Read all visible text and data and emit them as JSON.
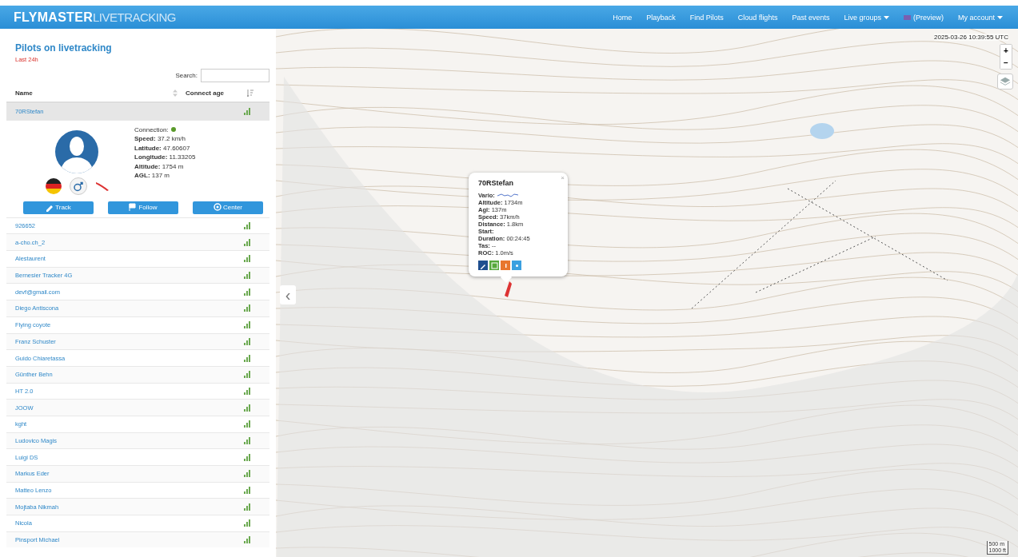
{
  "navbar": {
    "logo_bold": "FLYMASTER",
    "logo_light": "LIVETRACKING",
    "links": [
      {
        "label": "Home",
        "dropdown": false
      },
      {
        "label": "Playback",
        "dropdown": false
      },
      {
        "label": "Find Pilots",
        "dropdown": false
      },
      {
        "label": "Cloud flights",
        "dropdown": false
      },
      {
        "label": "Past events",
        "dropdown": false
      },
      {
        "label": "Live groups",
        "dropdown": true
      },
      {
        "label": "(Preview)",
        "dropdown": false,
        "flag": true
      },
      {
        "label": "My account",
        "dropdown": true
      }
    ]
  },
  "sidebar": {
    "title": "Pilots on livetracking",
    "subtitle": "Last 24h",
    "search": {
      "label": "Search:"
    },
    "columns": [
      "Name",
      "Connect age"
    ],
    "details": {
      "connection_label": "Connection:",
      "connected": true,
      "lines": [
        "**Speed:** 37.2 km/h",
        "**Latitude:** 47.60607",
        "**Longitude:** 11.33205",
        "**Altitude:** 1754 m",
        "**AGL:** 137 m"
      ],
      "buttons": [
        {
          "label": "Track",
          "kind": "pencil"
        },
        {
          "label": "Follow",
          "kind": "flag"
        },
        {
          "label": "Center",
          "kind": "target"
        }
      ]
    },
    "pilots": [
      {
        "name": "70RStefan",
        "expanded": true
      },
      {
        "name": "926652",
        "expanded": false
      },
      {
        "name": "a-cho.ch_2",
        "expanded": false
      },
      {
        "name": "Alestaurent",
        "expanded": false
      },
      {
        "name": "Bernesier Tracker 4G",
        "expanded": false
      },
      {
        "name": "devf@gmail.com",
        "expanded": false
      },
      {
        "name": "Diego Antiscona",
        "expanded": false
      },
      {
        "name": "Flying coyote",
        "expanded": false
      },
      {
        "name": "Franz Schuster",
        "expanded": false
      },
      {
        "name": "Guido Chiaretassa",
        "expanded": false
      },
      {
        "name": "Günther Behn",
        "expanded": false
      },
      {
        "name": "HT 2.0",
        "expanded": false
      },
      {
        "name": "JOOW",
        "expanded": false
      },
      {
        "name": "kght",
        "expanded": false
      },
      {
        "name": "Ludovico Magis",
        "expanded": false
      },
      {
        "name": "Luigi DS",
        "expanded": false
      },
      {
        "name": "Markus Eder",
        "expanded": false
      },
      {
        "name": "Matteo Lenzo",
        "expanded": false
      },
      {
        "name": "Mojtaba Nikmah",
        "expanded": false
      },
      {
        "name": "Nicola",
        "expanded": false
      },
      {
        "name": "Pinsport Michael",
        "expanded": false
      }
    ]
  },
  "map": {
    "timestamp": "2025-03-26 10:39:55 UTC",
    "zoom_in": "+",
    "zoom_out": "−",
    "collapse": "‹",
    "scale": [
      "500 m",
      "1000 ft"
    ],
    "popup": {
      "title": "70RStefan",
      "close": "×",
      "vario_label": "**Vario:**",
      "lines": [
        "**Altitude:** 1734m",
        "**Agl:** 137m",
        "**Speed:** 37km/h",
        "**Distance:** 1.8km",
        "**Start:**",
        "**Duration:** 00:24:45",
        "**Tas:** --",
        "**ROC:** 1.0m/s"
      ],
      "buttons": [
        {
          "kind": "pencil",
          "color": "#1f4f8f"
        },
        {
          "kind": "chart",
          "color": "#56a83c"
        },
        {
          "kind": "info",
          "color": "#e8772e"
        },
        {
          "kind": "share",
          "color": "#3aa0e0"
        }
      ]
    }
  }
}
